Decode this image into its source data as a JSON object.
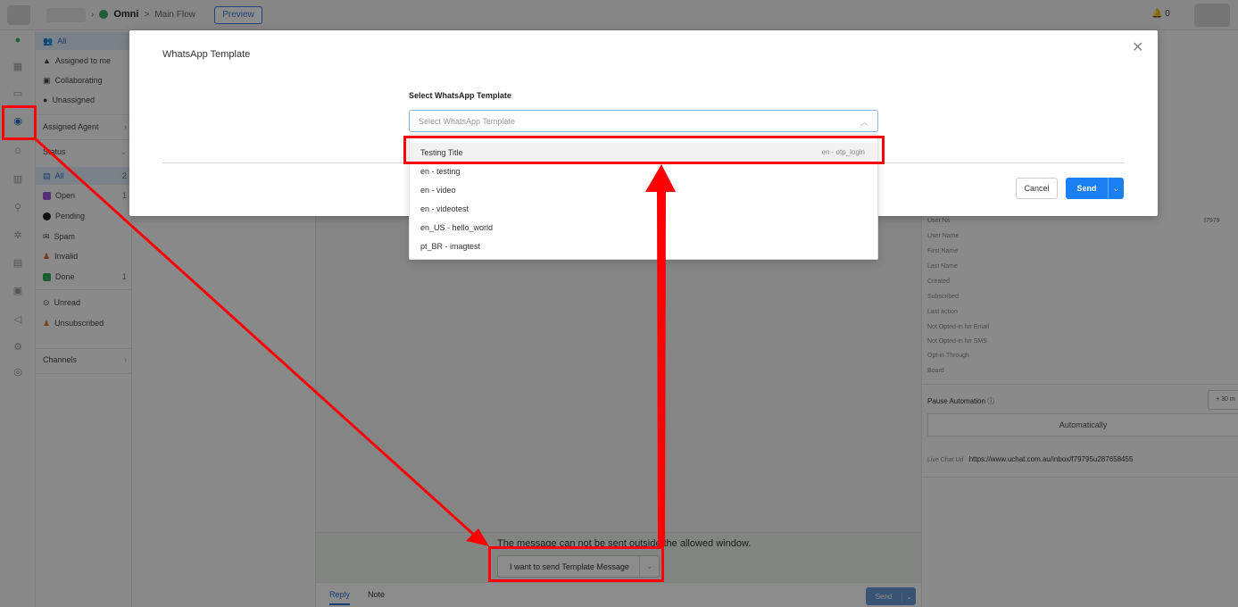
{
  "topbar": {
    "flow_name": "Omni",
    "crumb_sep": ">",
    "page_name": "Main Flow",
    "preview_label": "Preview",
    "notif_count": "0"
  },
  "filters": {
    "all": "All",
    "assigned_to_me": "Assigned to me",
    "collaborating": "Collaborating",
    "unassigned": "Unassigned",
    "assigned_agent": "Assigned Agent",
    "status": "Status",
    "status_all": "All",
    "status_all_count": "2",
    "open": "Open",
    "open_count": "1",
    "pending": "Pending",
    "spam": "Spam",
    "invalid": "Invalid",
    "done": "Done",
    "done_count": "1",
    "unread": "Unread",
    "unsubscribed": "Unsubscribed",
    "channels": "Channels"
  },
  "chat": {
    "warning": "The message can not be sent outside the allowed window.",
    "template_button": "I want to send Template Message",
    "reply_tab": "Reply",
    "note_tab": "Note",
    "send_label": "Send"
  },
  "info": {
    "fields": [
      "User Ns",
      "User Name",
      "First Name",
      "Last Name",
      "Created",
      "Subscribed",
      "Last action",
      "Not Opted-in for Email",
      "Not Opted-in for SMS",
      "Opt-in Through",
      "Board"
    ],
    "user_ns_value": "f7979",
    "pause_label": "Pause Automation ⓘ",
    "pause_btn": "+ 30 m",
    "automatically": "Automatically",
    "live_chat_label": "Live Chat Url",
    "live_chat_url": "https://www.uchat.com.au/inbox/f79795u287658455"
  },
  "modal": {
    "title": "WhatsApp Template",
    "field_label": "Select WhatsApp Template",
    "placeholder": "Select WhatsApp Template",
    "cancel": "Cancel",
    "send": "Send"
  },
  "dropdown": {
    "options": [
      {
        "label": "Testing Title",
        "tag": "en - otp_login"
      },
      {
        "label": "en - testing",
        "tag": ""
      },
      {
        "label": "en - video",
        "tag": ""
      },
      {
        "label": "en - videotest",
        "tag": ""
      },
      {
        "label": "en_US - hello_world",
        "tag": ""
      },
      {
        "label": "pt_BR - imagtest",
        "tag": ""
      }
    ]
  },
  "colors": {
    "accent": "#1a7ff2",
    "annotation": "#ff0000",
    "whatsapp_green": "#2eae5e"
  }
}
